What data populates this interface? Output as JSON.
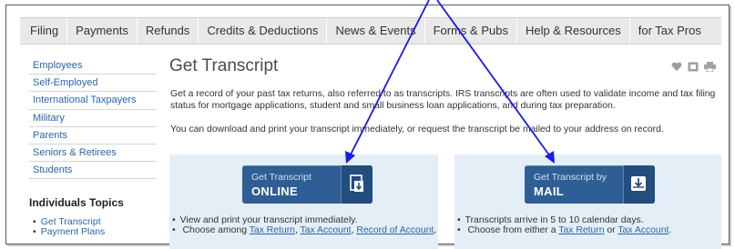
{
  "topnav": {
    "items": [
      "Filing",
      "Payments",
      "Refunds",
      "Credits & Deductions",
      "News & Events",
      "Forms & Pubs",
      "Help & Resources",
      "for Tax Pros"
    ]
  },
  "sidebar": {
    "items": [
      "Employees",
      "Self-Employed",
      "International Taxpayers",
      "Military",
      "Parents",
      "Seniors & Retirees",
      "Students"
    ],
    "heading": "Individuals Topics",
    "topics": [
      "Get Transcript",
      "Payment Plans"
    ]
  },
  "main": {
    "title": "Get Transcript",
    "intro": "Get a record of your past tax returns, also referred to as transcripts. IRS transcripts are often used to validate income and tax filing status for mortgage applications, student and small business loan applications, and during tax preparation.",
    "intro2": "You can download and print your transcript immediately, or request the transcript be mailed to your address on record."
  },
  "online_panel": {
    "button_line1": "Get Transcript",
    "button_line2": "ONLINE",
    "bullet1": "View and print your transcript immediately.",
    "bullet2_prefix": "Choose among ",
    "link1": "Tax Return",
    "sep1": ", ",
    "link2": "Tax Account",
    "sep2": ", ",
    "link3": "Record of Account",
    "suffix": ","
  },
  "mail_panel": {
    "button_line1": "Get Transcript by",
    "button_line2": "MAIL",
    "bullet1": "Transcripts arrive in 5 to 10 calendar days.",
    "bullet2_prefix": "Choose from either a ",
    "link1": "Tax Return",
    "sep1": " or ",
    "link2": "Tax Account",
    "suffix": "."
  },
  "icons": {
    "utility": [
      "heart-icon",
      "share-icon",
      "print-icon"
    ],
    "online_button": "download-document-icon",
    "mail_button": "mailbox-download-icon"
  },
  "colors": {
    "link": "#2b64a8",
    "button": "#2e5e94",
    "panel_bg": "#e4eef7",
    "annotation_arrow": "#1a1ae6"
  }
}
